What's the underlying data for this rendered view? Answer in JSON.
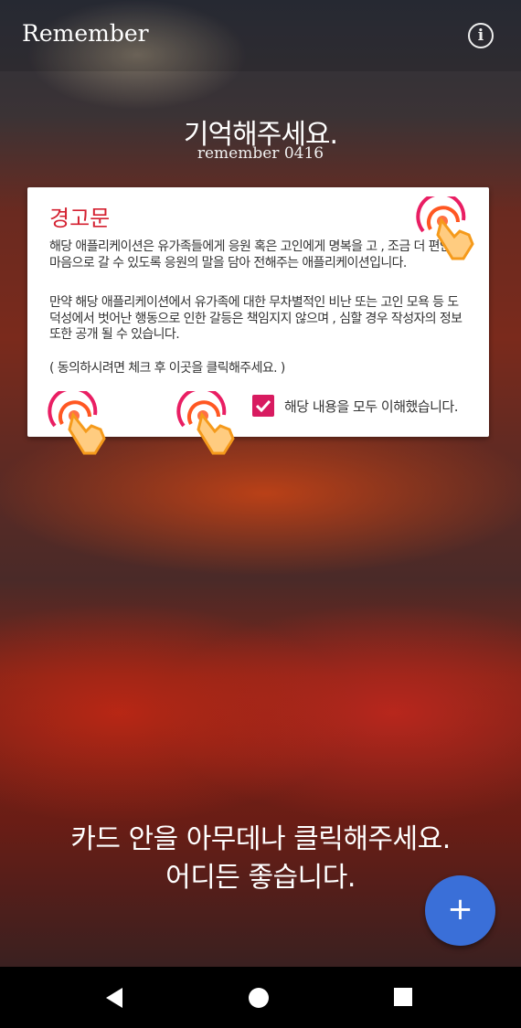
{
  "app_bar": {
    "title": "Remember",
    "info_icon": "info-icon"
  },
  "hero": {
    "headline": "기억해주세요.",
    "subtitle": "remember 0416"
  },
  "card": {
    "title": "경고문",
    "paragraph1": "해당 애플리케이션은 유가족들에게 응원 혹은 고인에게 명복을 고 , 조금 더 편안한 마음으로 갈 수 있도록 응원의 말을 담아 전해주는 애플리케이션입니다.",
    "paragraph2": "만약 해당 애플리케이션에서 유가족에 대한 무차별적인 비난 또는 고인 모욕 등 도덕성에서 벗어난 행동으로 인한 갈등은 책임지지 않으며 , 심할 경우 작성자의 정보 또한 공개 될 수 있습니다.",
    "instruction": "( 동의하시려면 체크 후 이곳을 클릭해주세요. )",
    "checkbox_label": "해당 내용을 모두 이해했습니다.",
    "checkbox_checked": true,
    "accent_color": "#d81b60"
  },
  "bottom_text": {
    "line1": "카드 안을 아무데나 클릭해주세요.",
    "line2": "어디든 좋습니다."
  },
  "fab": {
    "label": "+",
    "color": "#3a6fd8"
  },
  "nav": {
    "back": "back-icon",
    "home": "home-icon",
    "recents": "recents-icon"
  }
}
